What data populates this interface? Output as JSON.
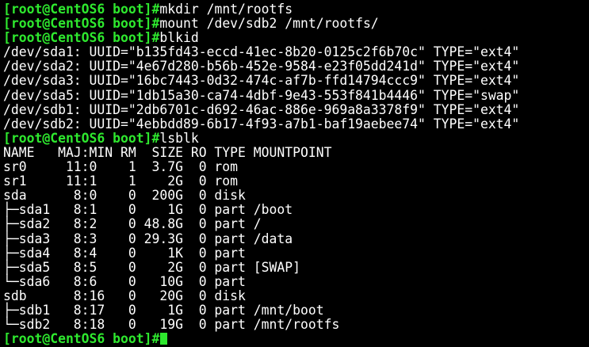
{
  "terminal": {
    "prompt": "[root@CentOS6 boot]#",
    "commands": {
      "mkdir": "mkdir /mnt/rootfs",
      "mount": "mount /dev/sdb2 /mnt/rootfs/",
      "blkid": "blkid",
      "lsblk": "lsblk",
      "final": ""
    },
    "blkid_output": [
      "/dev/sda1: UUID=\"b135fd43-eccd-41ec-8b20-0125c2f6b70c\" TYPE=\"ext4\"",
      "/dev/sda2: UUID=\"4e67d280-b56b-452e-9584-e23f05dd241d\" TYPE=\"ext4\"",
      "/dev/sda3: UUID=\"16bc7443-0d32-474c-af7b-ffd14794ccc9\" TYPE=\"ext4\"",
      "/dev/sda5: UUID=\"1db15a30-ca74-4dbf-9e43-553f841b4446\" TYPE=\"swap\"",
      "/dev/sdb1: UUID=\"2db6701c-d692-46ac-886e-969a8a3378f9\" TYPE=\"ext4\"",
      "/dev/sdb2: UUID=\"4ebbdd89-6b17-4f93-a7b1-baf19aebee74\" TYPE=\"ext4\""
    ],
    "lsblk_output": [
      "NAME   MAJ:MIN RM  SIZE RO TYPE MOUNTPOINT",
      "sr0     11:0    1  3.7G  0 rom",
      "sr1     11:1    1    2G  0 rom",
      "sda      8:0    0  200G  0 disk",
      "├─sda1   8:1    0    1G  0 part /boot",
      "├─sda2   8:2    0 48.8G  0 part /",
      "├─sda3   8:3    0 29.3G  0 part /data",
      "├─sda4   8:4    0    1K  0 part",
      "├─sda5   8:5    0    2G  0 part [SWAP]",
      "└─sda6   8:6    0   10G  0 part",
      "sdb      8:16   0   20G  0 disk",
      "├─sdb1   8:17   0    1G  0 part /mnt/boot",
      "└─sdb2   8:18   0   19G  0 part /mnt/rootfs"
    ],
    "colors": {
      "background": "#000000",
      "prompt": "#2ee82e",
      "text": "#ffffff",
      "cursor": "#2ee82e"
    }
  }
}
